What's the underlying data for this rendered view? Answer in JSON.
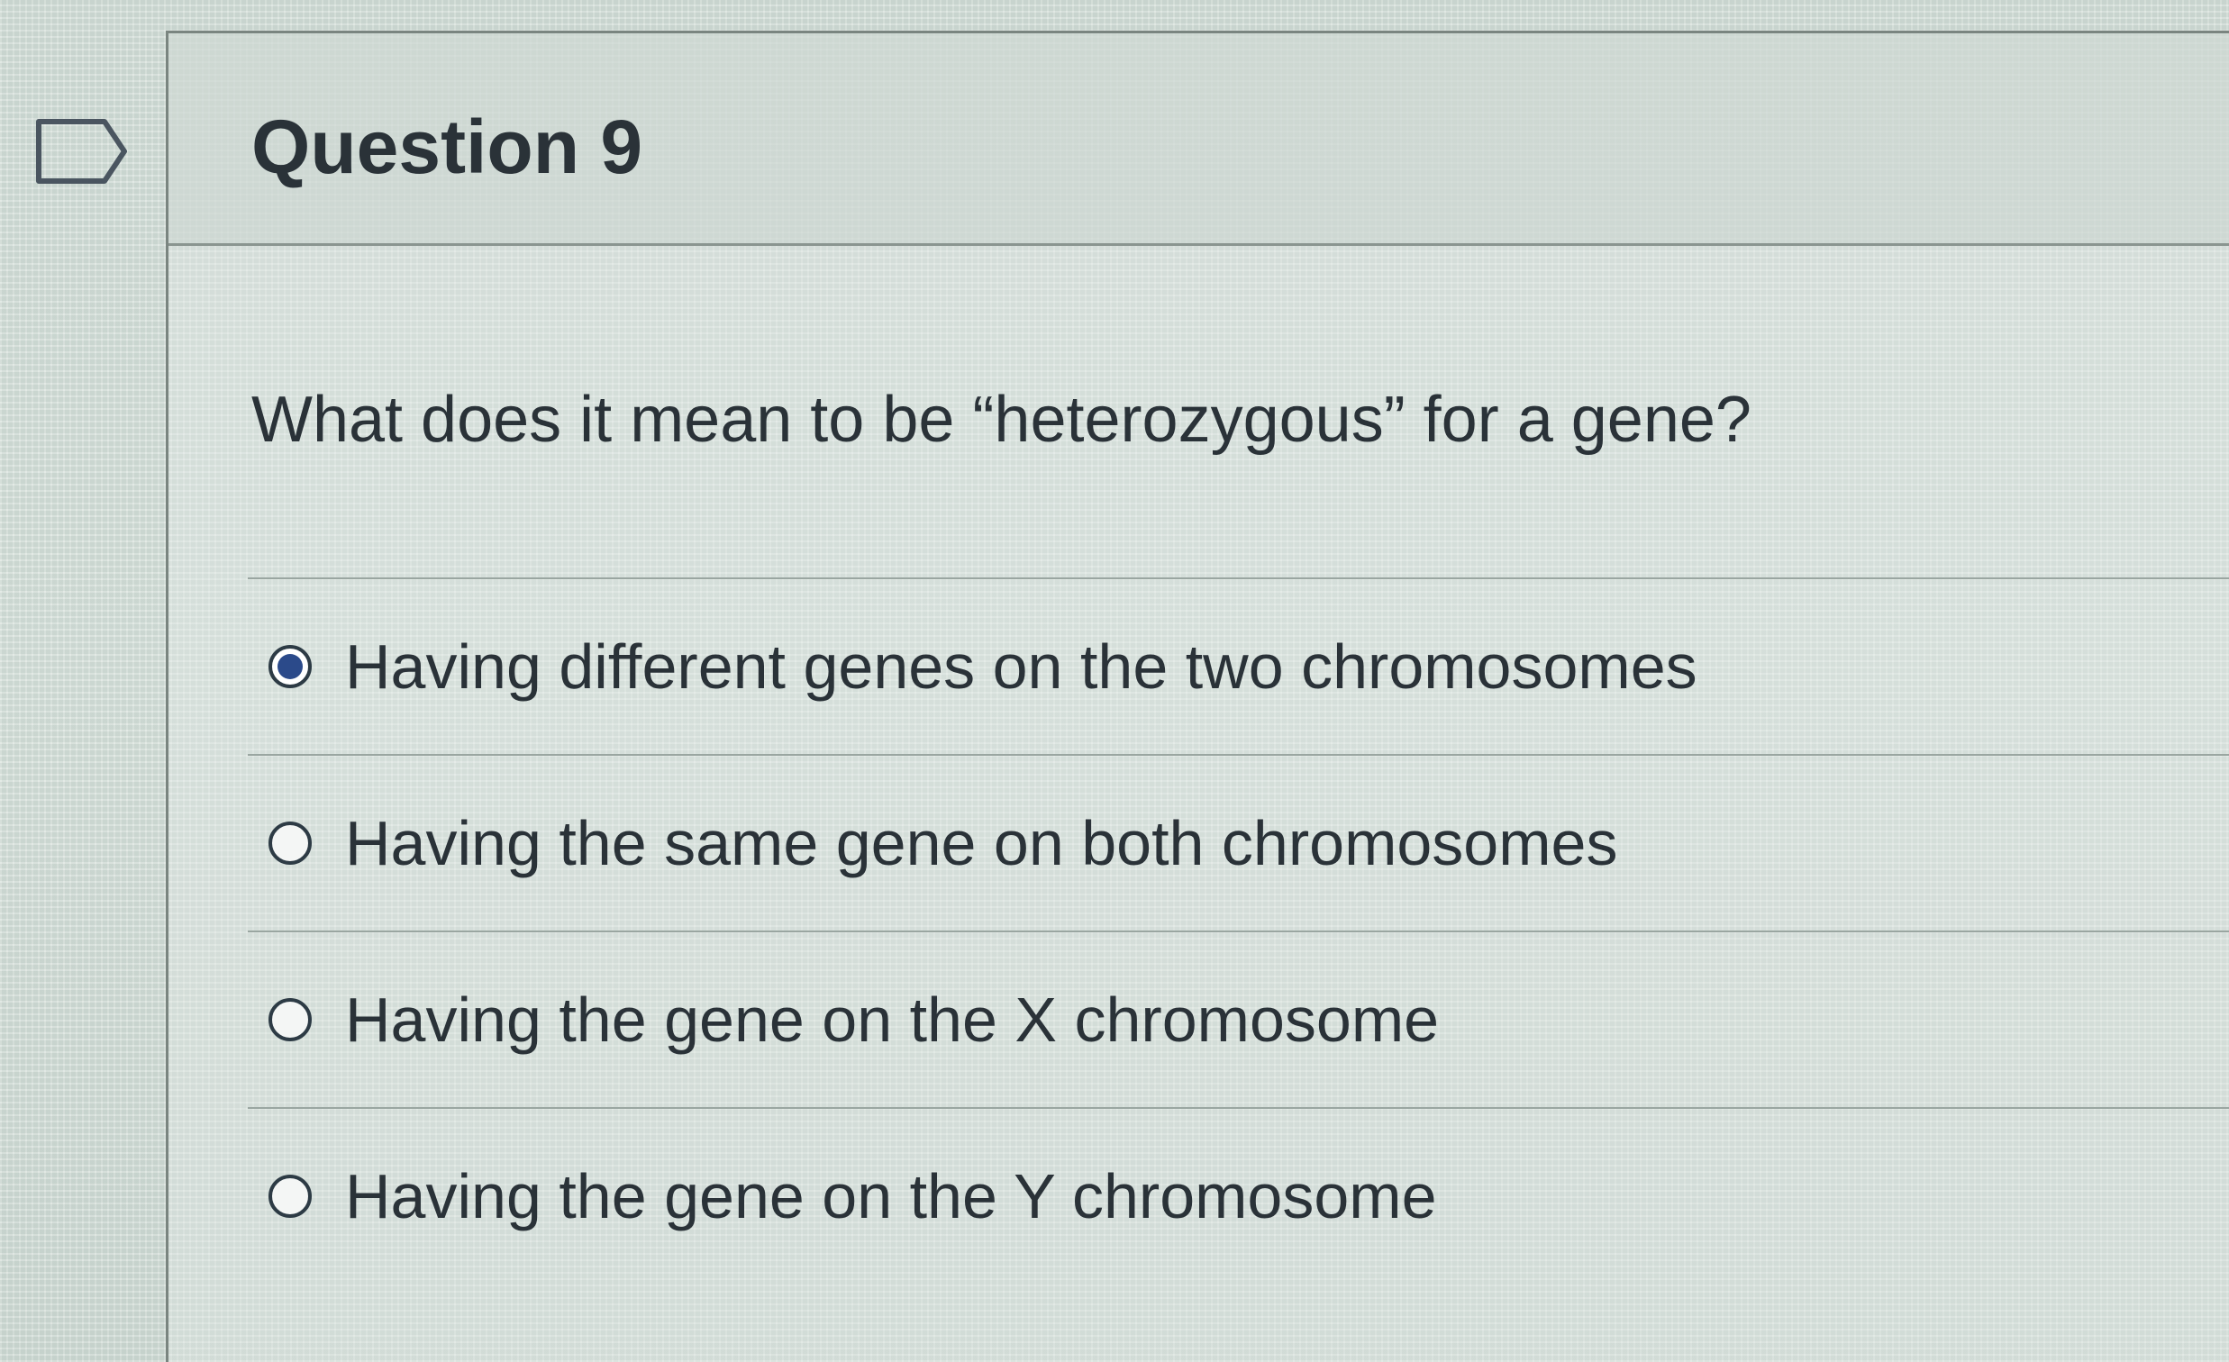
{
  "question": {
    "title": "Question 9",
    "text": "What does it mean to be “heterozygous” for a gene?",
    "flag_icon": "flag-question-icon",
    "answers": [
      {
        "label": "Having different genes on the two chromosomes",
        "selected": true
      },
      {
        "label": "Having the same gene on both chromosomes",
        "selected": false
      },
      {
        "label": "Having the gene on the X chromosome",
        "selected": false
      },
      {
        "label": "Having the gene on the Y chromosome",
        "selected": false
      }
    ]
  },
  "colors": {
    "radio_selected": "#2b4a8a",
    "radio_border": "#2d3b45",
    "text": "#2a3238"
  }
}
